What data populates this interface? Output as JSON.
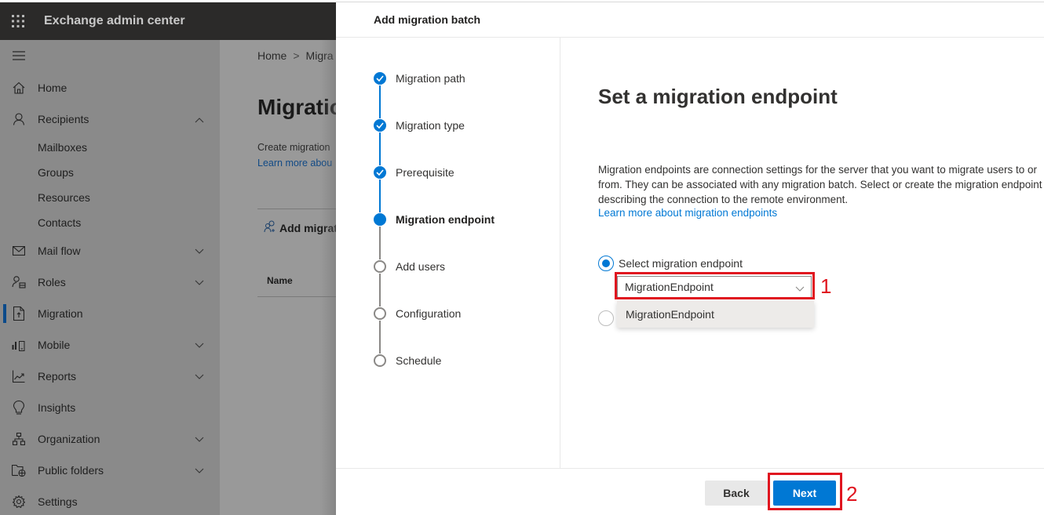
{
  "app": {
    "title": "Exchange admin center",
    "waffle_icon": "app-launcher-icon",
    "menu_icon": "hamburger-icon"
  },
  "sidebar": {
    "items": [
      {
        "label": "Home",
        "icon": "home-icon",
        "expandable": false
      },
      {
        "label": "Recipients",
        "icon": "person-icon",
        "expandable": true,
        "expanded": true,
        "children": [
          "Mailboxes",
          "Groups",
          "Resources",
          "Contacts"
        ]
      },
      {
        "label": "Mail flow",
        "icon": "mail-icon",
        "expandable": true
      },
      {
        "label": "Roles",
        "icon": "roles-icon",
        "expandable": true
      },
      {
        "label": "Migration",
        "icon": "migration-icon",
        "expandable": false,
        "active": true
      },
      {
        "label": "Mobile",
        "icon": "mobile-icon",
        "expandable": true
      },
      {
        "label": "Reports",
        "icon": "chart-icon",
        "expandable": true
      },
      {
        "label": "Insights",
        "icon": "lightbulb-icon",
        "expandable": false
      },
      {
        "label": "Organization",
        "icon": "org-icon",
        "expandable": true
      },
      {
        "label": "Public folders",
        "icon": "public-folder-icon",
        "expandable": true
      },
      {
        "label": "Settings",
        "icon": "gear-icon",
        "expandable": false
      }
    ]
  },
  "main": {
    "breadcrumb": [
      "Home",
      "Migra"
    ],
    "title": "Migratio",
    "description": "Create migration",
    "link": "Learn more abou",
    "add_button": "Add migrat",
    "column_name": "Name"
  },
  "panel": {
    "header": "Add migration batch",
    "steps": [
      {
        "label": "Migration path",
        "status": "done"
      },
      {
        "label": "Migration type",
        "status": "done"
      },
      {
        "label": "Prerequisite",
        "status": "done"
      },
      {
        "label": "Migration endpoint",
        "status": "current"
      },
      {
        "label": "Add users",
        "status": "todo"
      },
      {
        "label": "Configuration",
        "status": "todo"
      },
      {
        "label": "Schedule",
        "status": "todo"
      }
    ],
    "content": {
      "title": "Set a migration endpoint",
      "description": "Migration endpoints are connection settings for the server that you want to migrate users to or from. They can be associated with any migration batch. Select or create the migration endpoint describing the connection to the remote environment.",
      "link": "Learn more about migration endpoints",
      "radio_select_label": "Select migration endpoint",
      "radio_select_checked": true,
      "radio_create_checked": false,
      "dropdown_value": "MigrationEndpoint",
      "dropdown_options": [
        "MigrationEndpoint"
      ]
    },
    "footer": {
      "back_label": "Back",
      "next_label": "Next"
    }
  },
  "annotations": [
    {
      "label": "1",
      "target": "endpoint-dropdown"
    },
    {
      "label": "2",
      "target": "next-button"
    }
  ],
  "colors": {
    "accent": "#0078d4",
    "annotation": "#e0151f",
    "topbar": "#2b2a29"
  }
}
